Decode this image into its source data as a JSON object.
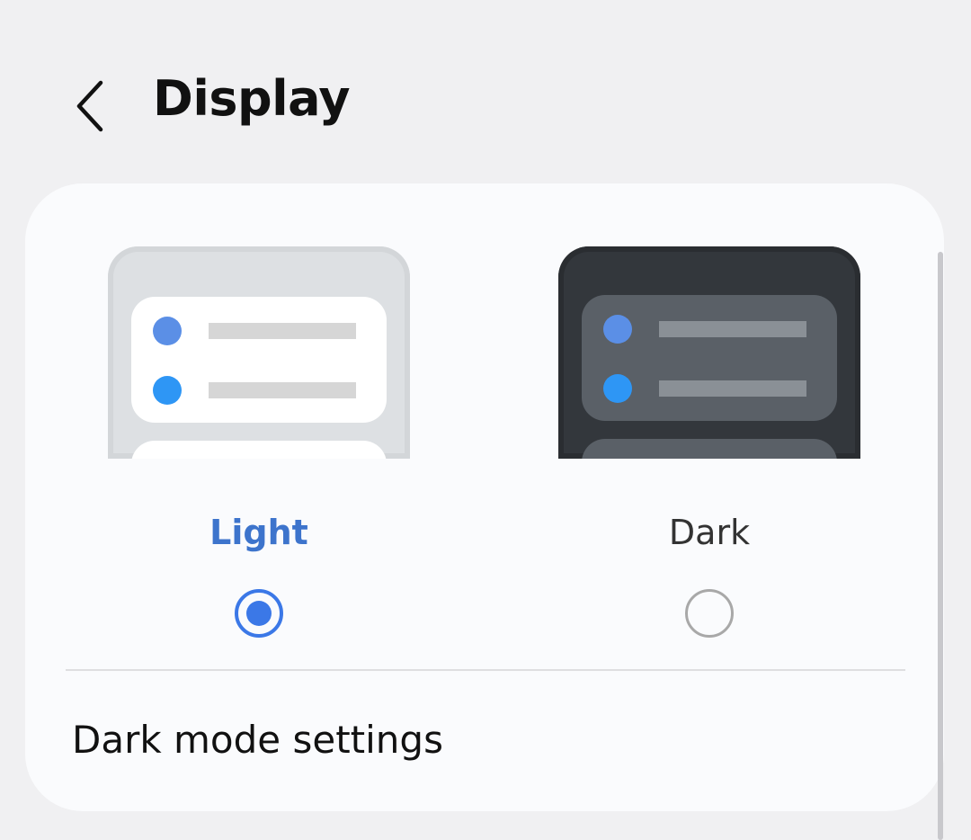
{
  "header": {
    "title": "Display",
    "back_icon": "chevron-left-icon"
  },
  "theme": {
    "options": [
      {
        "label": "Light",
        "selected": true
      },
      {
        "label": "Dark",
        "selected": false
      }
    ]
  },
  "settings": {
    "dark_mode_settings_label": "Dark mode settings"
  },
  "colors": {
    "accent": "#3b78e7",
    "background": "#f0f0f2",
    "card": "#fafbfd"
  }
}
